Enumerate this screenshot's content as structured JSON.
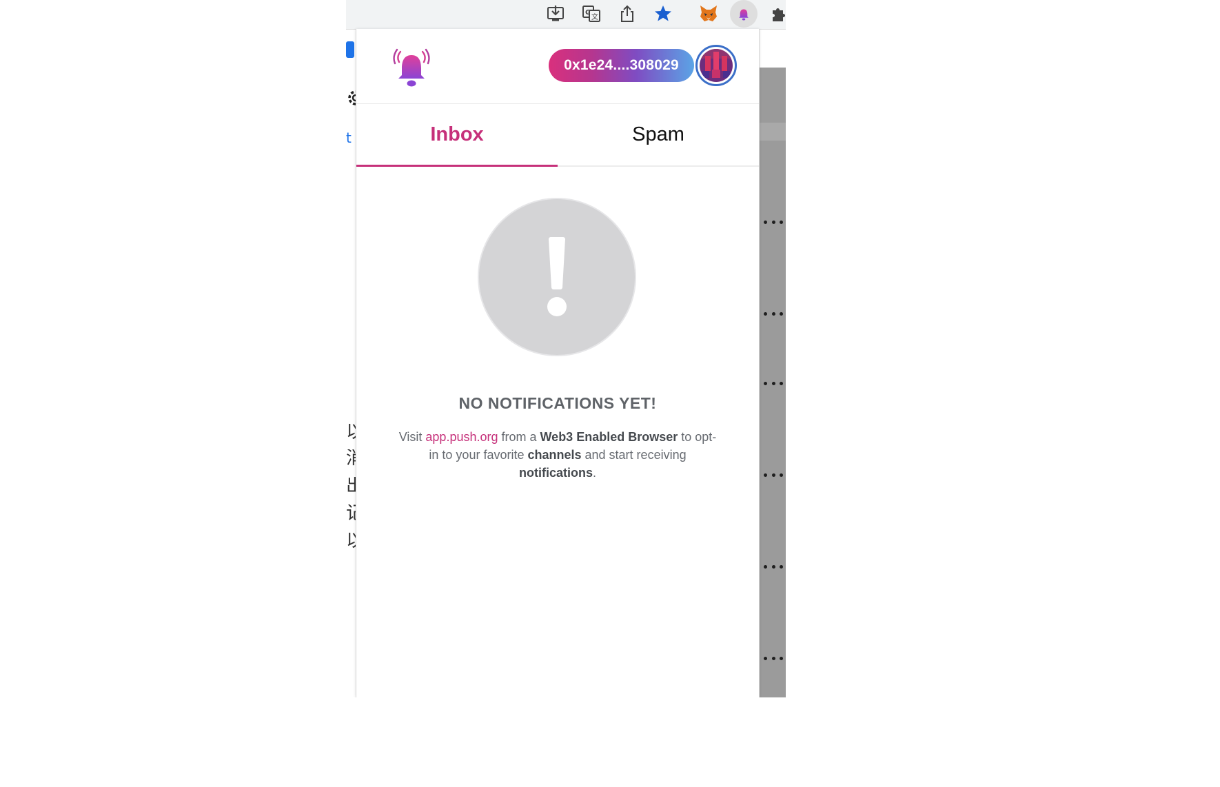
{
  "browser_toolbar": {
    "icons": [
      "install-icon",
      "translate-icon",
      "share-icon",
      "bookmark-star-icon",
      "metamask-fox-icon",
      "push-extension-icon",
      "extensions-puzzle-icon"
    ]
  },
  "background_page": {
    "left_fragments": [
      "t T",
      "以",
      "消",
      "出",
      "记",
      "以"
    ]
  },
  "popup": {
    "address": "0x1e24....308029",
    "tabs": [
      {
        "label": "Inbox",
        "active": true
      },
      {
        "label": "Spam",
        "active": false
      }
    ],
    "empty_state": {
      "title": "NO NOTIFICATIONS YET!",
      "desc_prefix": "Visit ",
      "link_text": "app.push.org",
      "desc_mid1": " from a ",
      "bold1": "Web3 Enabled Browser",
      "desc_mid2": " to opt-in to your favorite ",
      "bold2": "channels",
      "desc_mid3": " and start receiving ",
      "bold3": "notifications",
      "desc_suffix": "."
    }
  },
  "colors": {
    "accent": "#c6307a",
    "pill_gradient_start": "#d9307d",
    "pill_gradient_end": "#5ba4e6",
    "empty_circle": "#d4d4d6",
    "chrome_star": "#1a5fd0"
  }
}
